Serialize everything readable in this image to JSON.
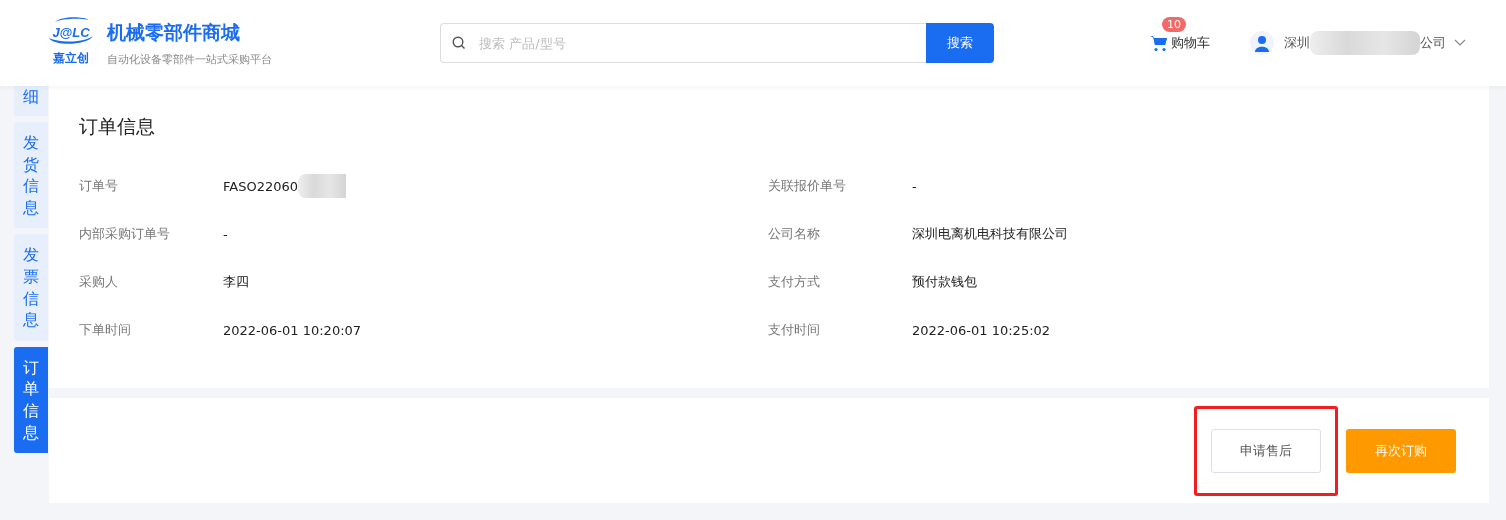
{
  "header": {
    "logo_text": "J@LC",
    "logo_name": "嘉立创",
    "site_title": "机械零部件商城",
    "site_subtitle": "自动化设备零部件一站式采购平台",
    "search": {
      "placeholder": "搜索 产品/型号",
      "button": "搜索"
    },
    "cart": {
      "count": "10",
      "label": "购物车"
    },
    "account": {
      "name_start": "深圳",
      "name_end": "公司",
      "redacted": true
    }
  },
  "side_tabs": [
    {
      "label": "细",
      "selected": false
    },
    {
      "label": "发货信息",
      "selected": false
    },
    {
      "label": "发票信息",
      "selected": false
    },
    {
      "label": "订单信息",
      "selected": true
    }
  ],
  "order_info": {
    "title": "订单信息",
    "fields": [
      {
        "label": "订单号",
        "value": "FASO22060",
        "redacted": true
      },
      {
        "label": "关联报价单号",
        "value": "-",
        "redacted": false
      },
      {
        "label": "内部采购订单号",
        "value": "-",
        "redacted": false
      },
      {
        "label": "公司名称",
        "value": "深圳电离机电科技有限公司",
        "redacted": false
      },
      {
        "label": "采购人",
        "value": "李四",
        "redacted": false
      },
      {
        "label": "支付方式",
        "value": "预付款钱包",
        "redacted": false
      },
      {
        "label": "下单时间",
        "value": "2022-06-01 10:20:07",
        "redacted": false
      },
      {
        "label": "支付时间",
        "value": "2022-06-01 10:25:02",
        "redacted": false
      }
    ]
  },
  "actions": [
    {
      "label": "申请售后",
      "kind": "secondary",
      "highlighted": true
    },
    {
      "label": "再次订购",
      "kind": "primary",
      "highlighted": false
    }
  ]
}
